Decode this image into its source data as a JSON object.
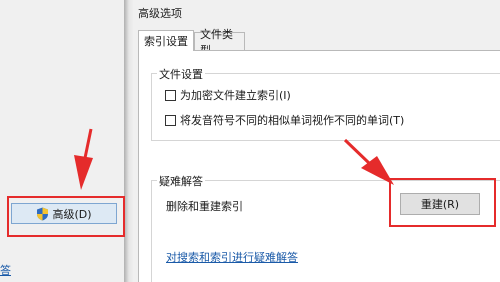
{
  "background_window": {
    "advanced_button_label": "高级(D)",
    "partial_link_text": "答"
  },
  "dialog": {
    "title": "高级选项",
    "tabs": [
      {
        "label": "索引设置",
        "selected": true
      },
      {
        "label": "文件类型",
        "selected": false
      }
    ],
    "file_settings": {
      "group_label": "文件设置",
      "options": [
        {
          "label": "为加密文件建立索引(I)",
          "checked": false
        },
        {
          "label": "将发音符号不同的相似单词视作不同的单词(T)",
          "checked": false
        }
      ]
    },
    "troubleshooting": {
      "group_label": "疑难解答",
      "description": "删除和重建索引",
      "rebuild_button_label": "重建(R)",
      "help_link": "对搜索和索引进行疑难解答"
    }
  },
  "annotations": {
    "highlight_color": "#e52b2b",
    "arrow_color": "#e52b2b"
  }
}
